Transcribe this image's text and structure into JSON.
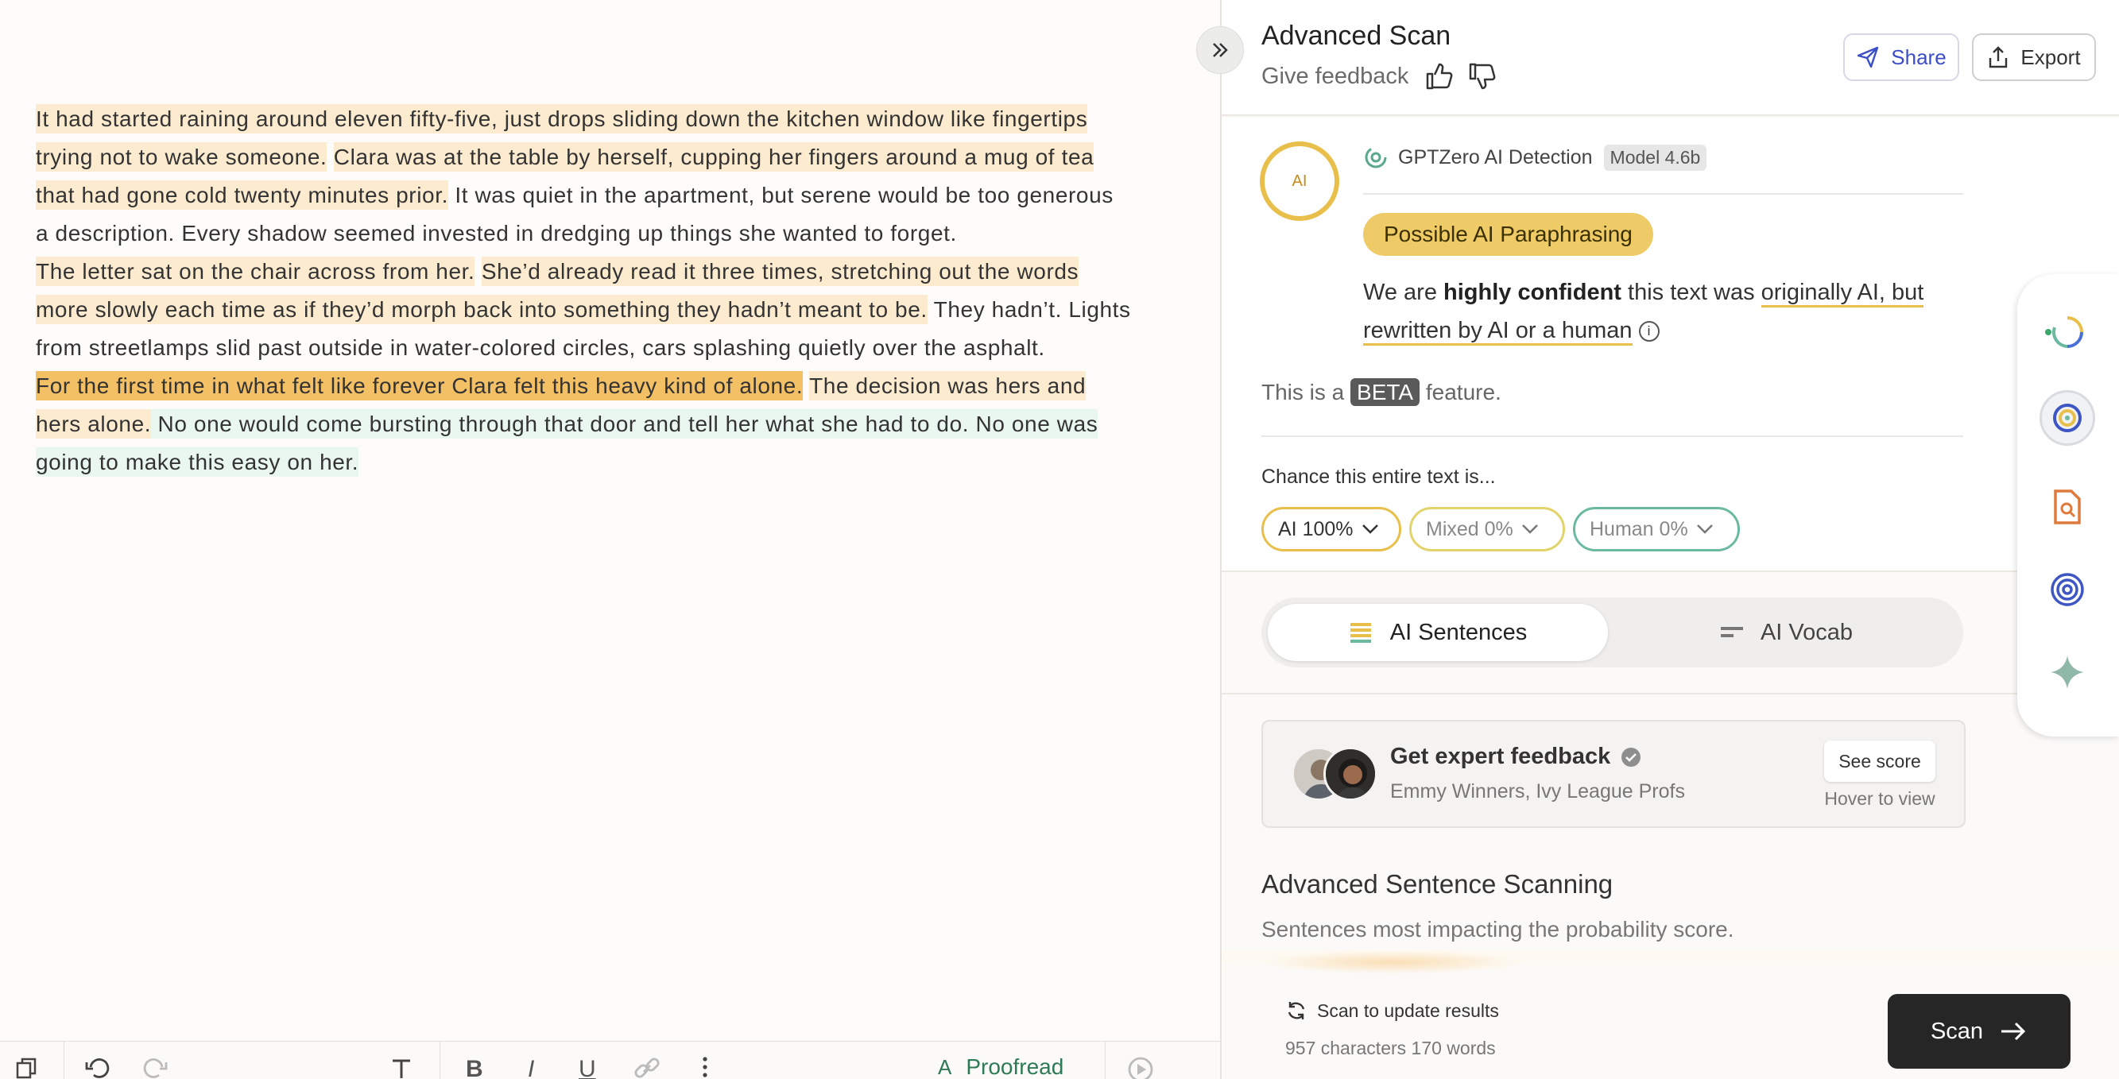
{
  "editor": {
    "paragraphs": [
      [
        {
          "text": "It had started raining around eleven fifty-five, just drops sliding down the kitchen window like fingertips trying not to wake someone.",
          "hl": "light"
        },
        {
          "text": " ",
          "hl": "none"
        },
        {
          "text": "Clara was at the table by herself, cupping her fingers around a mug of tea that had gone cold twenty minutes prior.",
          "hl": "light"
        },
        {
          "text": " It was quiet in the apartment, but serene would be too generous a description. Every shadow seemed invested in dredging up things she wanted to forget.",
          "hl": "none"
        }
      ],
      [
        {
          "text": "The letter sat on the chair across from her.",
          "hl": "light"
        },
        {
          "text": " ",
          "hl": "none"
        },
        {
          "text": "She’d already read it three times, stretching out the words more slowly each time as if they’d morph back into something they hadn’t meant to be.",
          "hl": "light"
        },
        {
          "text": " They hadn’t. Lights from streetlamps slid past outside in water-colored circles, cars splashing quietly over the asphalt.",
          "hl": "none"
        }
      ],
      [
        {
          "text": "For the first time in what felt like forever Clara felt this heavy kind of alone.",
          "hl": "strong"
        },
        {
          "text": " ",
          "hl": "none"
        },
        {
          "text": "The decision was hers and hers alone.",
          "hl": "light"
        },
        {
          "text": " No one would come bursting through that door and tell her what she had to do. No one was going to make this easy on her.",
          "hl": "mint"
        }
      ]
    ],
    "toolbar": {
      "proofread_label": "Proofread"
    }
  },
  "panel": {
    "title": "Advanced Scan",
    "give_feedback": "Give feedback",
    "share_label": "Share",
    "export_label": "Export",
    "detector_name": "GPTZero AI Detection",
    "model_badge": "Model 4.6b",
    "ring_label": "AI",
    "verdict": "Possible AI Paraphrasing",
    "confidence": {
      "pre": "We are ",
      "bold": "highly confident",
      "mid": " this text was ",
      "underlined": "originally AI, but rewritten by AI or a human"
    },
    "beta": {
      "pre": "This is a ",
      "tag": "BETA",
      "post": " feature."
    },
    "chance_label": "Chance this entire text is...",
    "chances": {
      "ai": "AI 100%",
      "mixed": "Mixed 0%",
      "human": "Human 0%"
    },
    "tabs": {
      "sentences": "AI Sentences",
      "vocab": "AI Vocab"
    },
    "expert": {
      "title": "Get expert feedback",
      "subtitle": "Emmy Winners, Ivy League Profs",
      "see_score": "See score",
      "hover_hint": "Hover to view"
    },
    "advanced": {
      "title": "Advanced Sentence Scanning",
      "subtitle": "Sentences most impacting the probability score."
    },
    "footer": {
      "scan_update": "Scan to update results",
      "counts": "957 characters 170 words",
      "scan_button": "Scan"
    }
  },
  "colors": {
    "highlight_light": "#fdebd0",
    "highlight_strong": "#f4c066",
    "highlight_mint": "#eaf6f0",
    "ai_yellow": "#e8bf4a",
    "human_green": "#6ab9a0",
    "share_blue": "#3b4ec7",
    "proofread_green": "#2f7a56"
  },
  "rail_icons": [
    "gptzero-logo-icon",
    "ai-scan-icon",
    "document-search-icon",
    "spiral-icon",
    "sparkle-icon"
  ]
}
